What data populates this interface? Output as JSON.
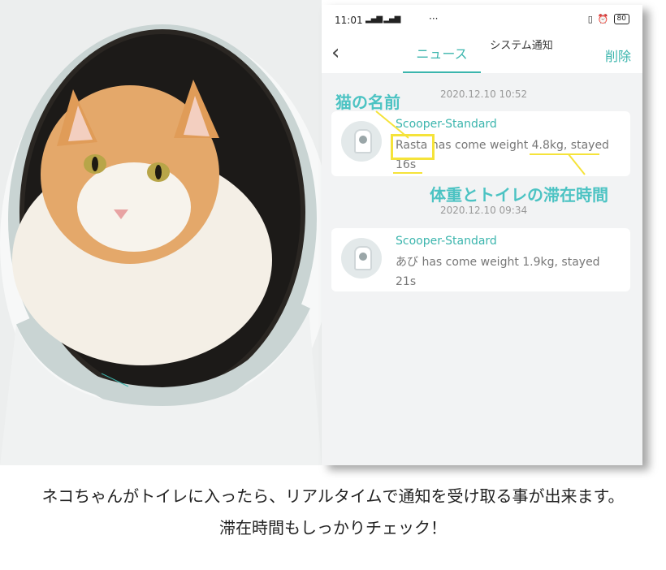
{
  "status": {
    "time": "11:01",
    "signal": "▂▄▆ ▂▄▆",
    "dots": "···",
    "battery": "80"
  },
  "nav": {
    "back": "‹",
    "tab_news": "ニュース",
    "tab_system": "システム通知",
    "delete": "削除"
  },
  "notices": [
    {
      "date": "2020.12.10 10:52",
      "device": "Scooper-Standard",
      "cat": "Rasta",
      "msg": "has come weight 4.8kg, stayed",
      "msg2": "16s"
    },
    {
      "date": "2020.12.10 09:34",
      "device": "Scooper-Standard",
      "cat": "あび",
      "msg": "has come weight 1.9kg, stayed",
      "msg2": "21s"
    }
  ],
  "annotations": {
    "cat_name": "猫の名前",
    "weight_stay": "体重とトイレの滞在時間"
  },
  "caption": {
    "line1": "ネコちゃんがトイレに入ったら、リアルタイムで通知を受け取る事が出来ます。",
    "line2": "滞在時間もしっかりチェック！"
  },
  "colors": {
    "accent": "#3bb5ad",
    "annotation": "#4cc3c3",
    "highlight": "#f5e33a"
  }
}
